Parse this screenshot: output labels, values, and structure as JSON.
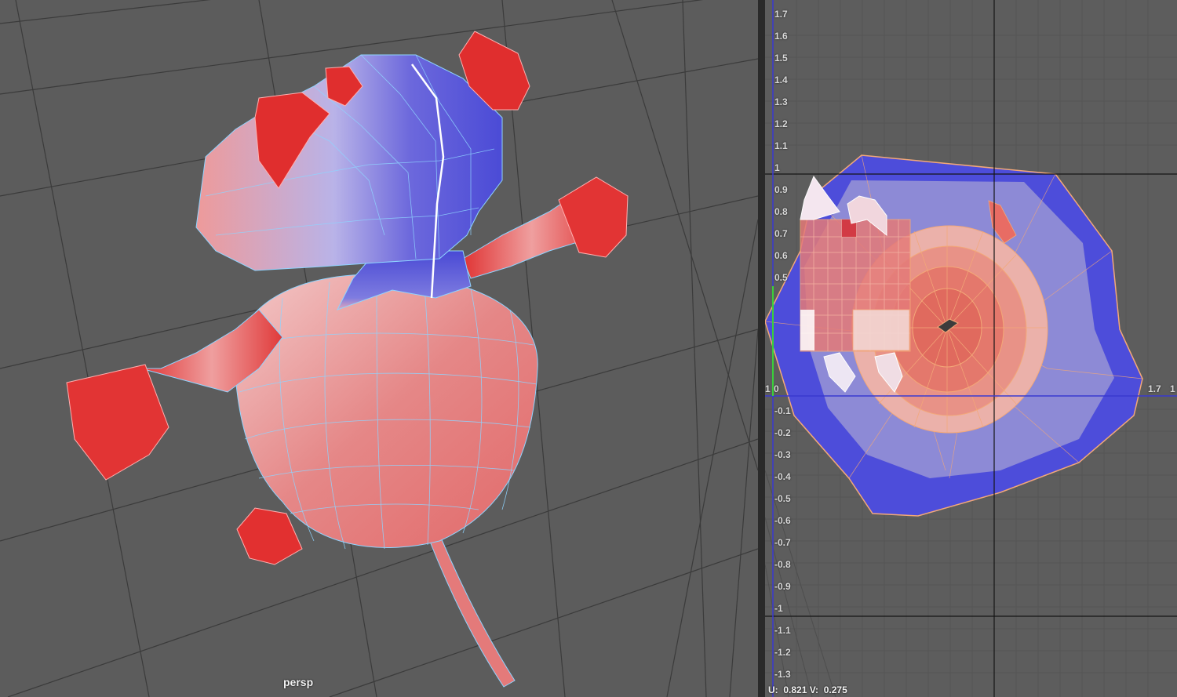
{
  "perspective_view": {
    "camera_label": "persp"
  },
  "uv_editor": {
    "v_ticks": [
      "1.7",
      "1.6",
      "1.5",
      "1.4",
      "1.3",
      "1.2",
      "1.1",
      "1",
      "0.9",
      "0.8",
      "0.7",
      "0.6",
      "0.5",
      "-0.1",
      "-0.2",
      "-0.3",
      "-0.4",
      "-0.5",
      "-0.6",
      "-0.7",
      "-0.8",
      "-0.9",
      "-1",
      "-1.1",
      "-1.2",
      "-1.3"
    ],
    "u_ticks": [
      "1",
      "0",
      "1.7",
      "1"
    ],
    "readout": {
      "u_label": "U:",
      "u_value": "0.821",
      "v_label": "V:",
      "v_value": "0.275"
    }
  },
  "colors": {
    "viewport_bg": "#5c5c5c",
    "grid_line": "#3a3a3a",
    "mesh_red": "#e03434",
    "mesh_pink": "#ec8c8c",
    "mesh_blue": "#4b4bd9",
    "wire": "#8fd4ff",
    "uv_border": "#f0a070"
  }
}
